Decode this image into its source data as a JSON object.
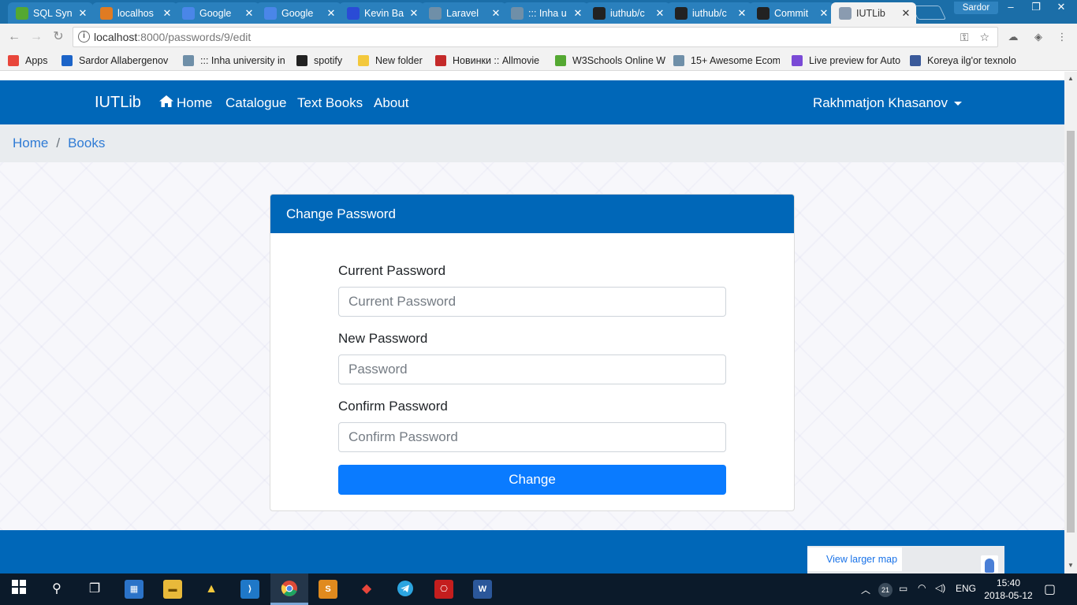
{
  "browser": {
    "tabs": [
      {
        "title": "SQL Syn",
        "favicon_color": "#54a832",
        "active": false
      },
      {
        "title": "localhos",
        "favicon_color": "#e07b22",
        "active": false
      },
      {
        "title": "Google",
        "favicon_color": "#4a86e8",
        "active": false
      },
      {
        "title": "Google",
        "favicon_color": "#4a86e8",
        "active": false
      },
      {
        "title": "Kevin Ba",
        "favicon_color": "#2a4bd6",
        "active": false
      },
      {
        "title": "Laravel",
        "favicon_color": "#6f8fa8",
        "active": false
      },
      {
        "title": "::: Inha u",
        "favicon_color": "#6f8fa8",
        "active": false
      },
      {
        "title": "iuthub/c",
        "favicon_color": "#222222",
        "active": false
      },
      {
        "title": "iuthub/c",
        "favicon_color": "#222222",
        "active": false
      },
      {
        "title": "Commit",
        "favicon_color": "#222222",
        "active": false
      },
      {
        "title": "IUTLib",
        "favicon_color": "#8a9bb0",
        "active": true
      }
    ],
    "profile_name": "Sardor",
    "window_controls": {
      "minimize": "–",
      "restore": "❐",
      "close": "✕"
    },
    "url_host": "localhost",
    "url_path": ":8000/passwords/9/edit",
    "bookmarks": [
      {
        "label": "Apps",
        "color": "#e8463b"
      },
      {
        "label": "Sardor Allabergenov",
        "color": "#1c64c8"
      },
      {
        "label": "::: Inha university in t",
        "color": "#6f8fa8"
      },
      {
        "label": "spotify",
        "color": "#222222"
      },
      {
        "label": "New folder",
        "color": "#f3c83c"
      },
      {
        "label": "Новинки :: Allmovie",
        "color": "#c42a2a"
      },
      {
        "label": "W3Schools Online W",
        "color": "#54a832"
      },
      {
        "label": "15+ Awesome Ecom",
        "color": "#6f8fa8"
      },
      {
        "label": "Live preview for Auto",
        "color": "#7a4ad6"
      },
      {
        "label": "Koreya ilg'or texnolo",
        "color": "#3a5a9a"
      }
    ]
  },
  "site": {
    "brand": "IUTLib",
    "nav": {
      "home": "Home",
      "catalogue": "Catalogue",
      "textbooks": "Text Books",
      "about": "About"
    },
    "user_name": "Rakhmatjon Khasanov",
    "breadcrumb": {
      "home": "Home",
      "separator": "/",
      "books": "Books"
    },
    "colors": {
      "primary": "#0067b8",
      "button": "#0a7bff",
      "link": "#2f7bd5"
    }
  },
  "form": {
    "title": "Change Password",
    "current_label": "Current Password",
    "current_placeholder": "Current Password",
    "new_label": "New Password",
    "new_placeholder": "Password",
    "confirm_label": "Confirm Password",
    "confirm_placeholder": "Confirm Password",
    "submit_label": "Change"
  },
  "footer": {
    "map_link": "View larger map"
  },
  "taskbar": {
    "language": "ENG",
    "time": "15:40",
    "date": "2018-05-12",
    "notification_count": "21"
  }
}
